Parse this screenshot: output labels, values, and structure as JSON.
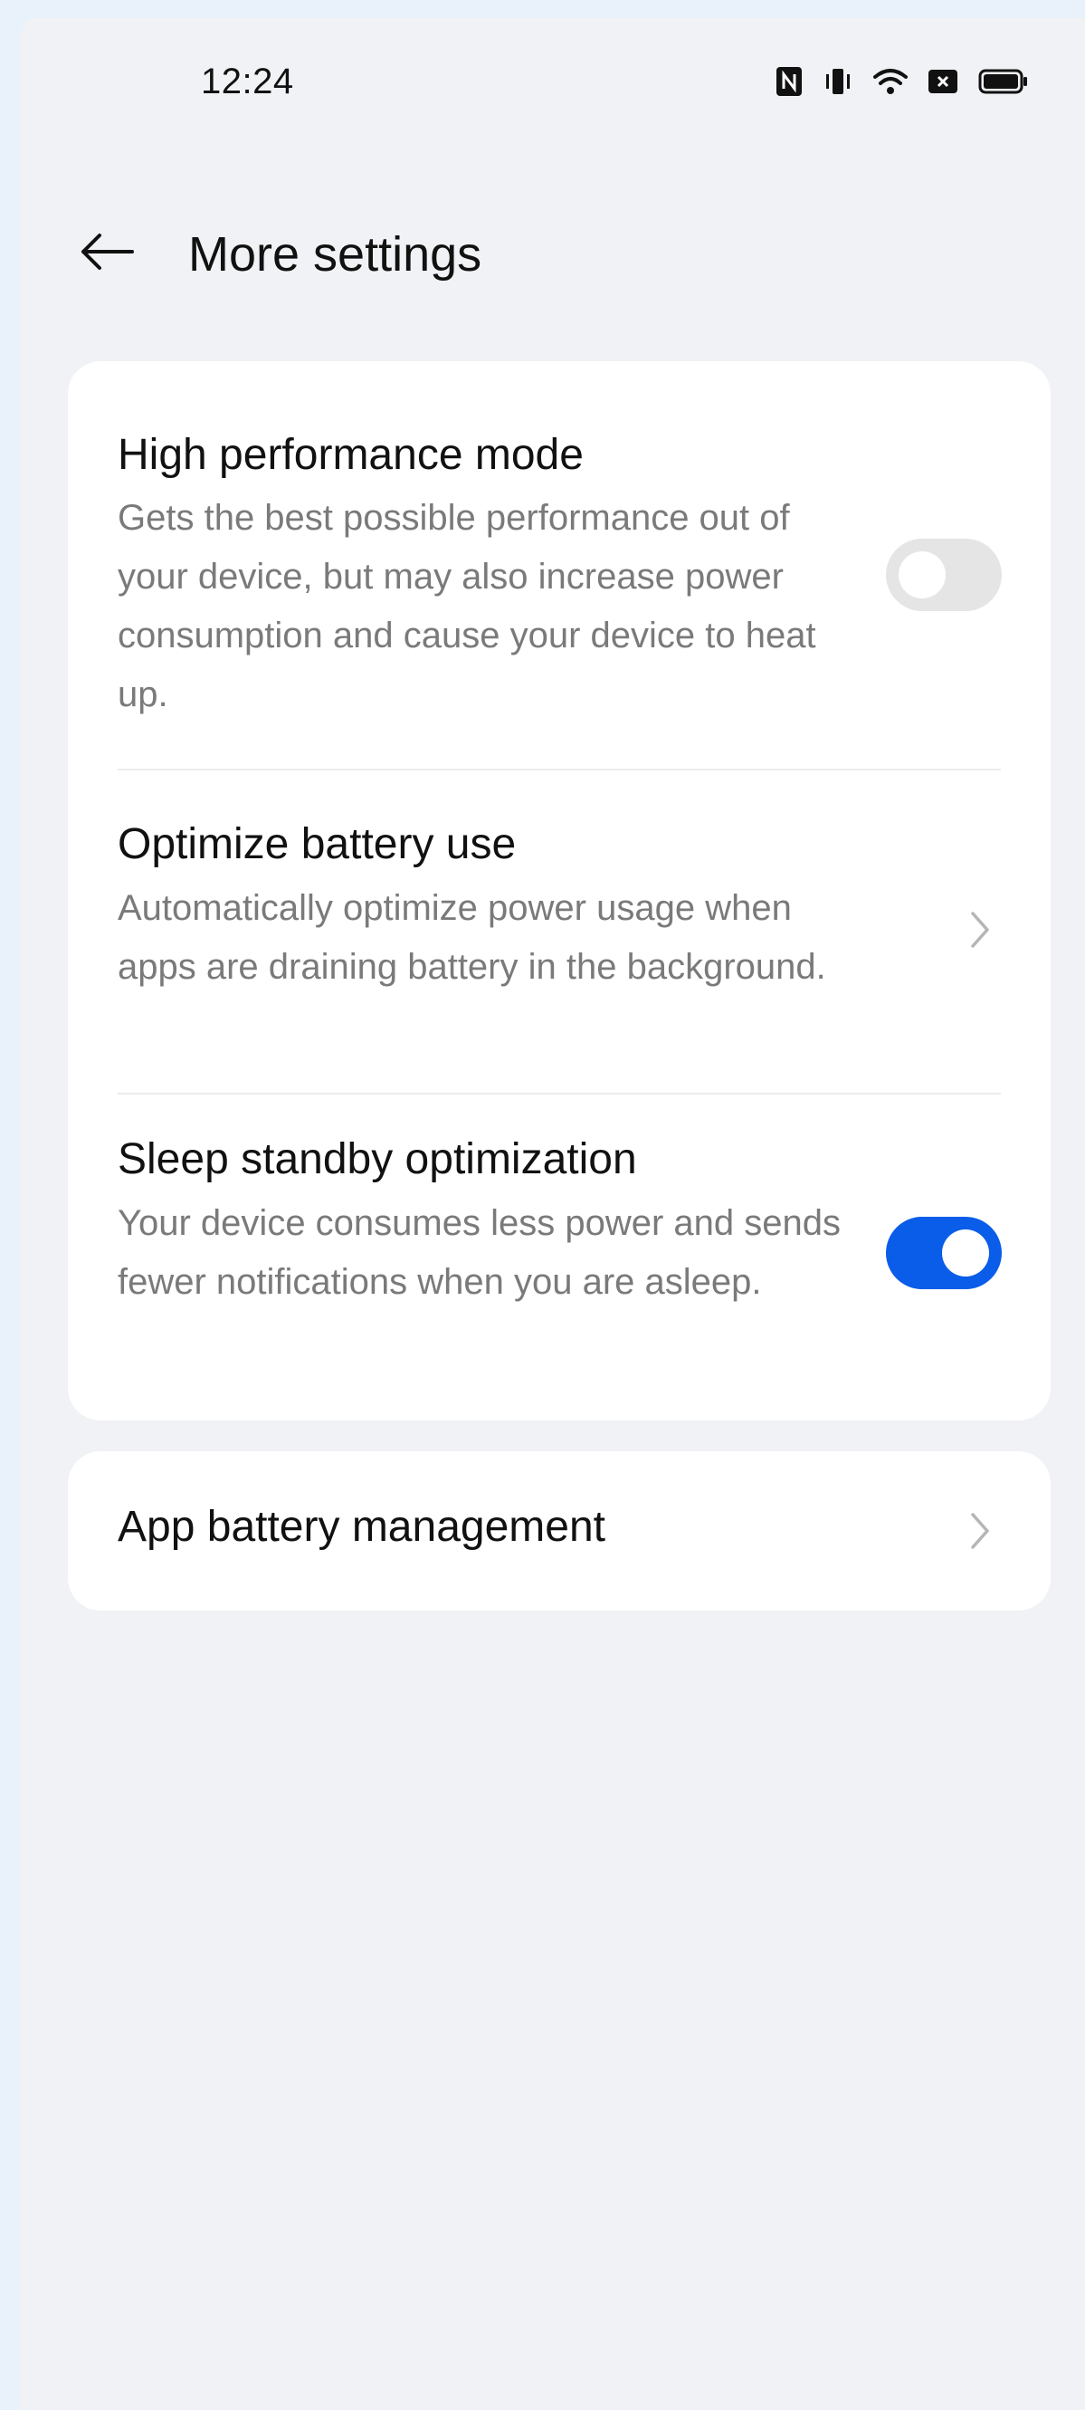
{
  "status_bar": {
    "time": "12:24",
    "icons": [
      "nfc-icon",
      "vibrate-icon",
      "wifi-icon",
      "sim-blocked-icon",
      "battery-icon"
    ]
  },
  "header": {
    "back_icon": "arrow-left-icon",
    "title": "More settings"
  },
  "settings": [
    {
      "title": "High performance mode",
      "description": "Gets the best possible performance out of your device, but may also increase power consumption and cause your device to heat up.",
      "control": "toggle",
      "enabled": false
    },
    {
      "title": "Optimize battery use",
      "description": "Automatically optimize power usage when apps are draining battery in the background.",
      "control": "chevron"
    },
    {
      "title": "Sleep standby optimization",
      "description": "Your device consumes less power and sends fewer notifications when you are asleep.",
      "control": "toggle",
      "enabled": true
    }
  ],
  "app_battery": {
    "title": "App battery management",
    "control": "chevron"
  },
  "colors": {
    "accent": "#0a5de8",
    "toggle_off": "#e5e5e5",
    "background": "#f1f2f5",
    "card": "#ffffff"
  }
}
